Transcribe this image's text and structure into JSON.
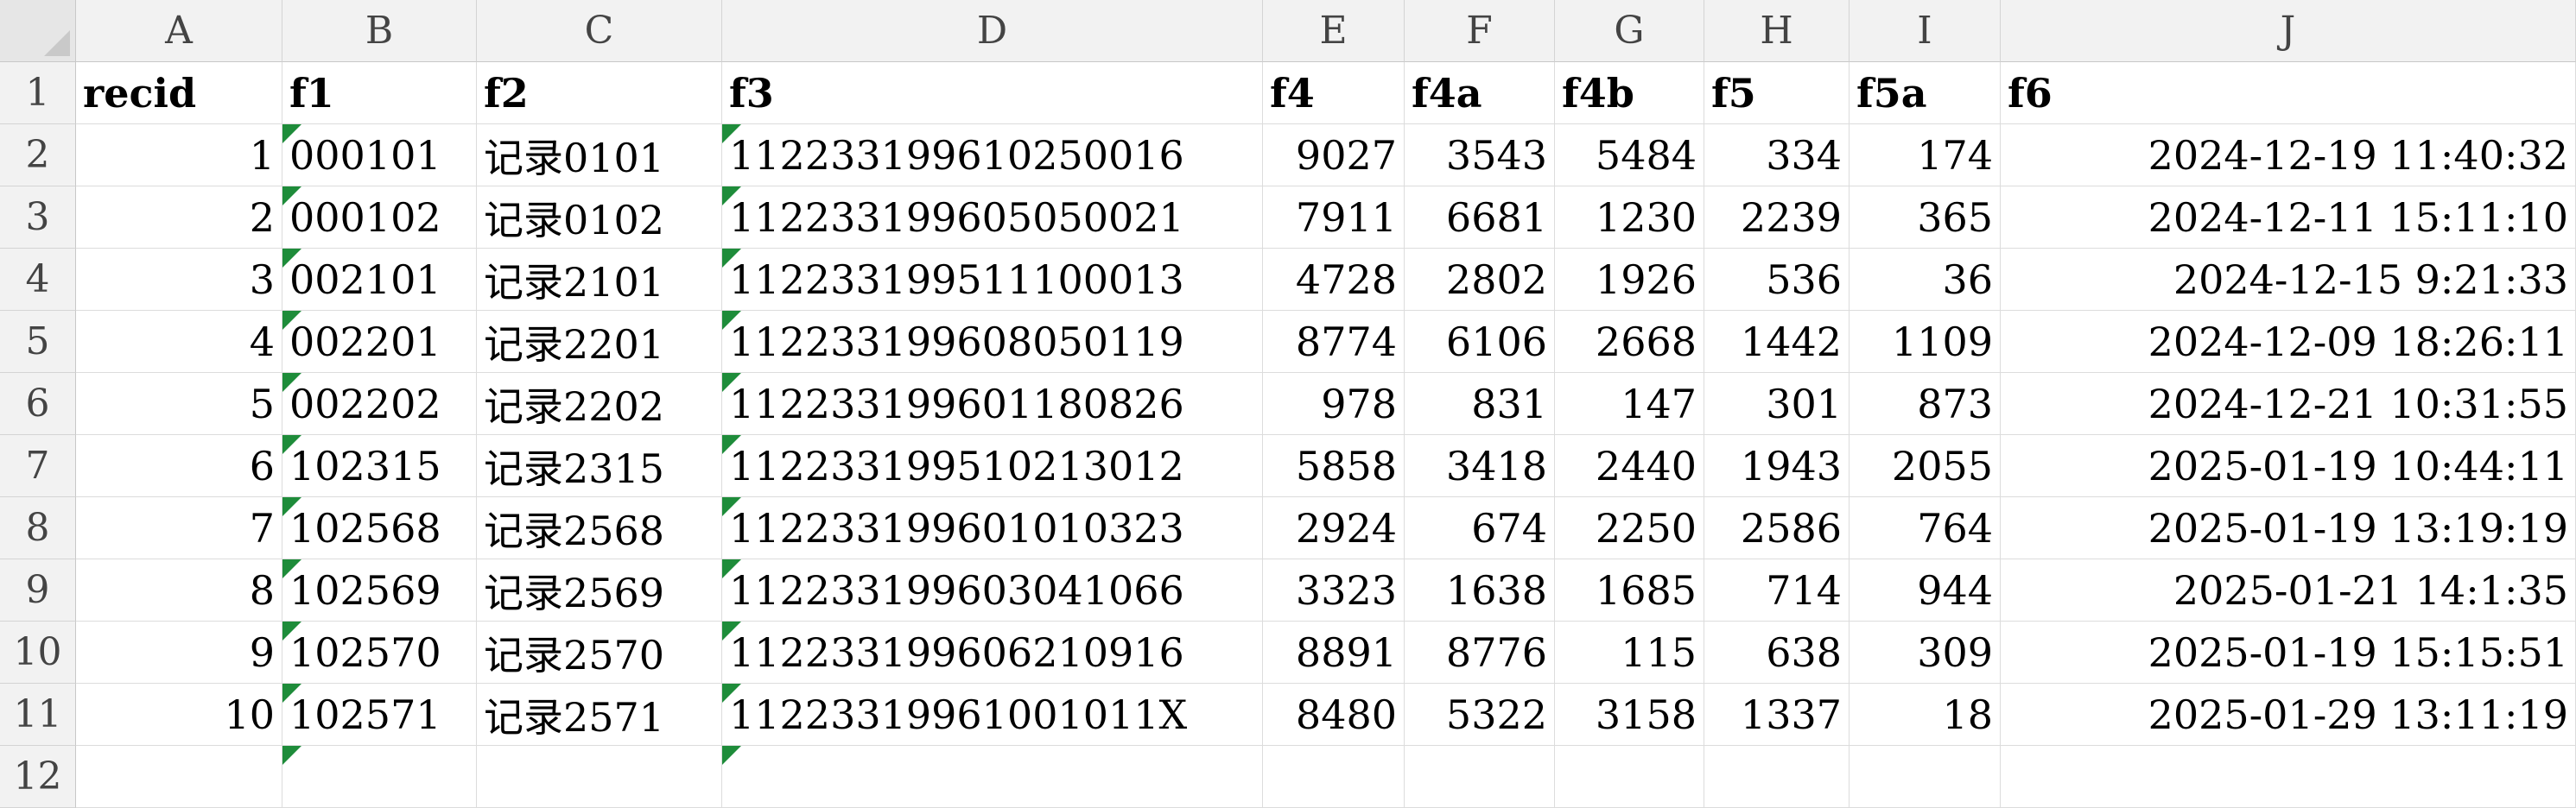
{
  "columns": [
    "A",
    "B",
    "C",
    "D",
    "E",
    "F",
    "G",
    "H",
    "I",
    "J"
  ],
  "rows": [
    "1",
    "2",
    "3",
    "4",
    "5",
    "6",
    "7",
    "8",
    "9",
    "10",
    "11",
    "12"
  ],
  "header": [
    "recid",
    "f1",
    "f2",
    "f3",
    "f4",
    "f4a",
    "f4b",
    "f5",
    "f5a",
    "f6"
  ],
  "data": [
    [
      "1",
      "000101",
      "记录0101",
      "112233199610250016",
      "9027",
      "3543",
      "5484",
      "334",
      "174",
      "2024-12-19  11:40:32"
    ],
    [
      "2",
      "000102",
      "记录0102",
      "112233199605050021",
      "7911",
      "6681",
      "1230",
      "2239",
      "365",
      "2024-12-11  15:11:10"
    ],
    [
      "3",
      "002101",
      "记录2101",
      "112233199511100013",
      "4728",
      "2802",
      "1926",
      "536",
      "36",
      "2024-12-15  9:21:33"
    ],
    [
      "4",
      "002201",
      "记录2201",
      "112233199608050119",
      "8774",
      "6106",
      "2668",
      "1442",
      "1109",
      "2024-12-09  18:26:11"
    ],
    [
      "5",
      "002202",
      "记录2202",
      "112233199601180826",
      "978",
      "831",
      "147",
      "301",
      "873",
      "2024-12-21  10:31:55"
    ],
    [
      "6",
      "102315",
      "记录2315",
      "112233199510213012",
      "5858",
      "3418",
      "2440",
      "1943",
      "2055",
      "2025-01-19  10:44:11"
    ],
    [
      "7",
      "102568",
      "记录2568",
      "112233199601010323",
      "2924",
      "674",
      "2250",
      "2586",
      "764",
      "2025-01-19  13:19:19"
    ],
    [
      "8",
      "102569",
      "记录2569",
      "112233199603041066",
      "3323",
      "1638",
      "1685",
      "714",
      "944",
      "2025-01-21  14:1:35"
    ],
    [
      "9",
      "102570",
      "记录2570",
      "112233199606210916",
      "8891",
      "8776",
      "115",
      "638",
      "309",
      "2025-01-19  15:15:51"
    ],
    [
      "10",
      "102571",
      "记录2571",
      "11223319961001011X",
      "8480",
      "5322",
      "3158",
      "1337",
      "18",
      "2025-01-29  13:11:19"
    ],
    [
      "",
      "",
      "",
      "",
      "",
      "",
      "",
      "",
      "",
      ""
    ]
  ],
  "text_marker_color": "#1e8c3a"
}
